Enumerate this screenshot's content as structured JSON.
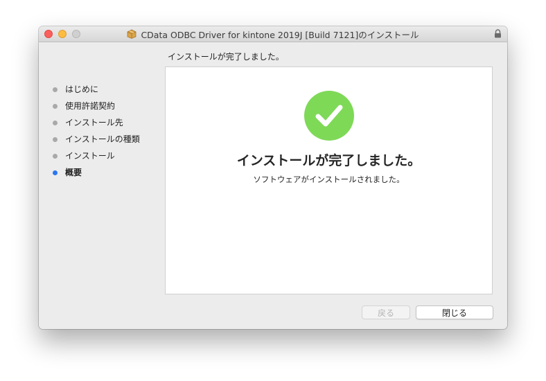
{
  "window": {
    "title": "CData ODBC Driver for kintone 2019J [Build 7121]のインストール"
  },
  "header": {
    "label": "インストールが完了しました。"
  },
  "sidebar": {
    "steps": [
      {
        "label": "はじめに",
        "active": false
      },
      {
        "label": "使用許諾契約",
        "active": false
      },
      {
        "label": "インストール先",
        "active": false
      },
      {
        "label": "インストールの種類",
        "active": false
      },
      {
        "label": "インストール",
        "active": false
      },
      {
        "label": "概要",
        "active": true
      }
    ]
  },
  "main": {
    "heading": "インストールが完了しました。",
    "message": "ソフトウェアがインストールされました。"
  },
  "buttons": {
    "back_label": "戻る",
    "close_label": "閉じる"
  },
  "colors": {
    "success_green": "#7ed957",
    "active_dot": "#2a76f1",
    "inactive_dot": "#a9a9a9"
  },
  "icons": [
    "package-icon",
    "lock-icon",
    "checkmark-circle-icon"
  ]
}
